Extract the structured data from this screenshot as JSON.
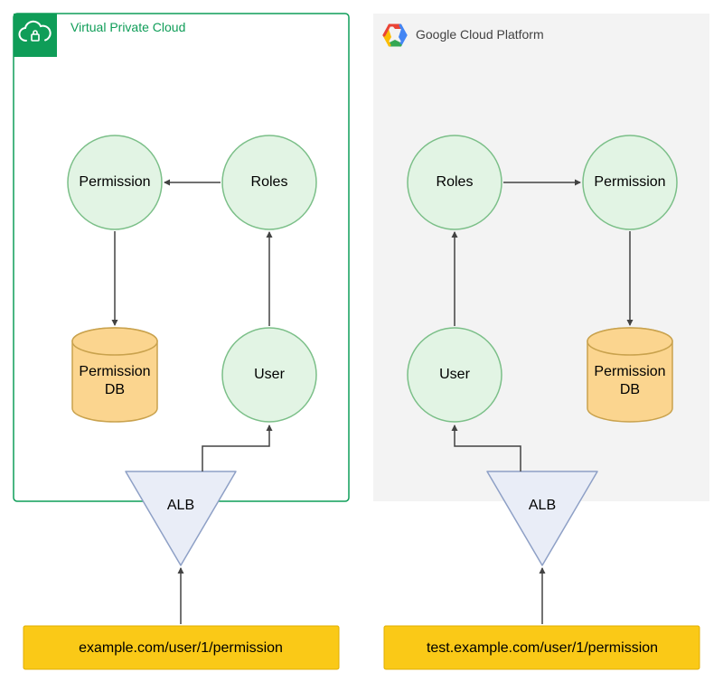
{
  "left": {
    "header": "Virtual Private Cloud",
    "nodes": {
      "permission": "Permission",
      "roles": "Roles",
      "user": "User",
      "db_l1": "Permission",
      "db_l2": "DB",
      "alb": "ALB"
    },
    "url": "example.com/user/1/permission"
  },
  "right": {
    "header": "Google Cloud Platform",
    "nodes": {
      "permission": "Permission",
      "roles": "Roles",
      "user": "User",
      "db_l1": "Permission",
      "db_l2": "DB",
      "alb": "ALB"
    },
    "url": "test.example.com/user/1/permission"
  },
  "colors": {
    "vpc_border": "#0f9d58",
    "vpc_icon_bg": "#0f9d58",
    "gcp_bg": "#f3f3f3",
    "circle_fill": "#e2f4e4",
    "circle_stroke": "#7bbf88",
    "db_fill": "#fbd58f",
    "db_stroke": "#c9a24d",
    "alb_fill": "#e9edf7",
    "alb_stroke": "#8ea0c6",
    "url_fill": "#fac917",
    "url_stroke": "#e0ae00",
    "arrow": "#424242"
  }
}
